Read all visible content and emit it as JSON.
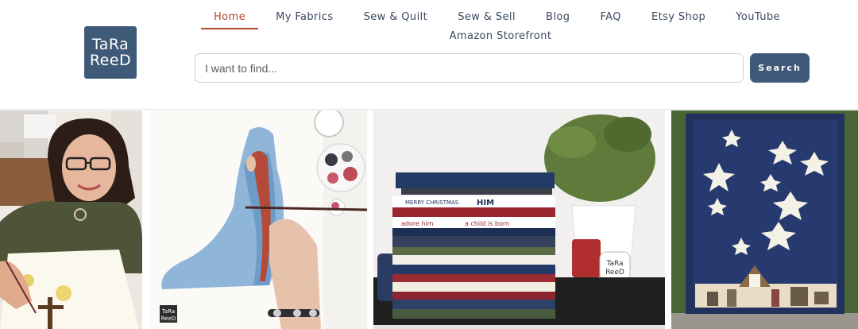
{
  "brand": {
    "logo_line1": "TaRa",
    "logo_line2": "ReeD"
  },
  "nav": {
    "items": [
      "Home",
      "My Fabrics",
      "Sew & Quilt",
      "Sew & Sell",
      "Blog",
      "FAQ",
      "Etsy Shop",
      "YouTube"
    ],
    "second_row": "Amazon Storefront",
    "active": "Home"
  },
  "search": {
    "placeholder": "I want to find...",
    "button_label": "Search"
  },
  "gallery": {
    "photos": [
      {
        "name": "artist-portrait",
        "icon": "photo"
      },
      {
        "name": "mary-watercolor-painting",
        "icon": "photo",
        "watermark": "TaRa ReeD"
      },
      {
        "name": "fabric-stack",
        "icon": "photo",
        "fabric_text": [
          "MERRY CHRISTMAS",
          "HIM",
          "adore him",
          "a child is born"
        ],
        "tag_text": "TaRa ReeD"
      },
      {
        "name": "nativity-quilt",
        "icon": "photo"
      }
    ]
  },
  "colors": {
    "brand_blue": "#3f5a78",
    "active_red": "#b0462e",
    "nav_text": "#3a4a5e"
  }
}
